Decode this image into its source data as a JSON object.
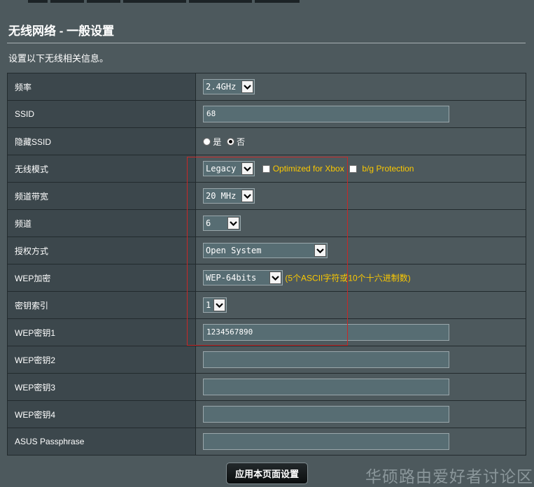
{
  "page": {
    "title": "无线网络 - 一般设置",
    "description": "设置以下无线相关信息。"
  },
  "rows": {
    "band": {
      "label": "频率",
      "value": "2.4GHz"
    },
    "ssid": {
      "label": "SSID",
      "value": "68"
    },
    "hide_ssid": {
      "label": "隐藏SSID",
      "option_yes": "是",
      "option_no": "否",
      "selected": "否"
    },
    "wireless_mode": {
      "label": "无线模式",
      "value": "Legacy",
      "xbox_label": "Optimized for Xbox",
      "xbox_checked": false,
      "bg_label": "b/g Protection",
      "bg_checked": false
    },
    "channel_bandwidth": {
      "label": "频道带宽",
      "value": "20 MHz"
    },
    "channel": {
      "label": "频道",
      "value": "6"
    },
    "auth_method": {
      "label": "授权方式",
      "value": "Open System"
    },
    "wep_encryption": {
      "label": "WEP加密",
      "value": "WEP-64bits",
      "hint": "(5个ASCII字符或10个十六进制数)"
    },
    "key_index": {
      "label": "密钥索引",
      "value": "1"
    },
    "wep_key1": {
      "label": "WEP密钥1",
      "value": "1234567890"
    },
    "wep_key2": {
      "label": "WEP密钥2",
      "value": ""
    },
    "wep_key3": {
      "label": "WEP密钥3",
      "value": ""
    },
    "wep_key4": {
      "label": "WEP密钥4",
      "value": ""
    },
    "passphrase": {
      "label": "ASUS Passphrase",
      "value": ""
    }
  },
  "apply_button": "应用本页面设置",
  "watermark": "华硕路由爱好者讨论区",
  "colors": {
    "background": "#4d595d",
    "label_cell": "#3c474c",
    "field": "#576d73",
    "hint_text": "#fcc900",
    "annotation": "#c62828"
  },
  "icons": {
    "dropdown": "chevron-down-icon"
  }
}
